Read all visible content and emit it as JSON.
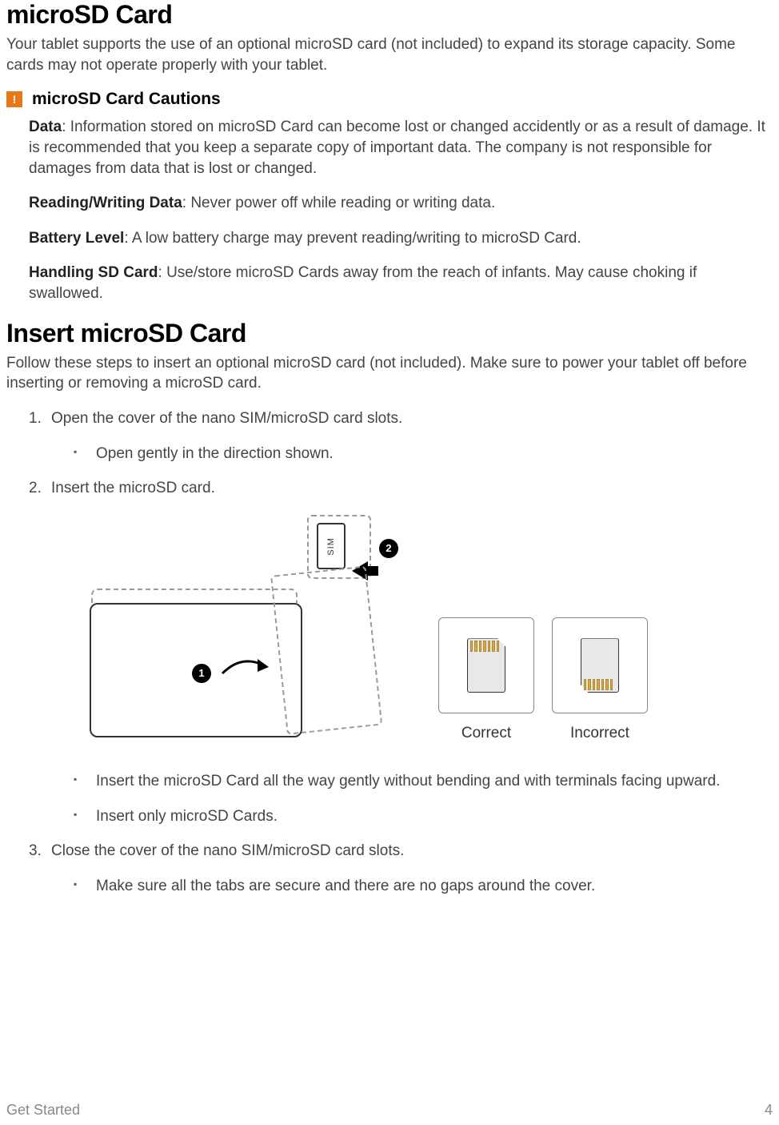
{
  "title1": "microSD Card",
  "intro": "Your tablet supports the use of an optional microSD card (not included) to expand its storage capacity. Some cards may not operate properly with your tablet.",
  "cautions_heading": "microSD Card Cautions",
  "cautions": [
    {
      "label": "Data",
      "text": ": Information stored on microSD Card can become lost or changed accidently or as a result of damage. It is recommended that you keep a separate copy of important data. The company is not responsible for damages from data that is lost or changed."
    },
    {
      "label": "Reading/Writing Data",
      "text": ": Never power off while reading or writing data."
    },
    {
      "label": "Battery Level",
      "text": ": A low battery charge may prevent reading/writing to microSD Card."
    },
    {
      "label": "Handling SD Card",
      "text": ": Use/store microSD Cards away from the reach of infants. May cause choking if swallowed."
    }
  ],
  "title2": "Insert microSD Card",
  "intro2": "Follow these steps to insert an optional microSD card (not included). Make sure to power your tablet off before inserting or removing a microSD card.",
  "steps": {
    "s1": {
      "num": "1.",
      "text": "Open the cover of the nano SIM/microSD card slots.",
      "sub": [
        "Open gently in the direction shown."
      ]
    },
    "s2": {
      "num": "2.",
      "text": "Insert the microSD card.",
      "sub": [
        "Insert the microSD Card all the way gently without bending and with terminals facing upward.",
        "Insert only microSD Cards."
      ]
    },
    "s3": {
      "num": "3.",
      "text": "Close the cover of the nano SIM/microSD card slots.",
      "sub": [
        "Make sure all the tabs are secure and there are no gaps around the cover."
      ]
    }
  },
  "illustration": {
    "sim_label": "SIM",
    "badge1": "1",
    "badge2": "2",
    "correct": "Correct",
    "incorrect": "Incorrect"
  },
  "footer": {
    "section": "Get Started",
    "page": "4"
  }
}
